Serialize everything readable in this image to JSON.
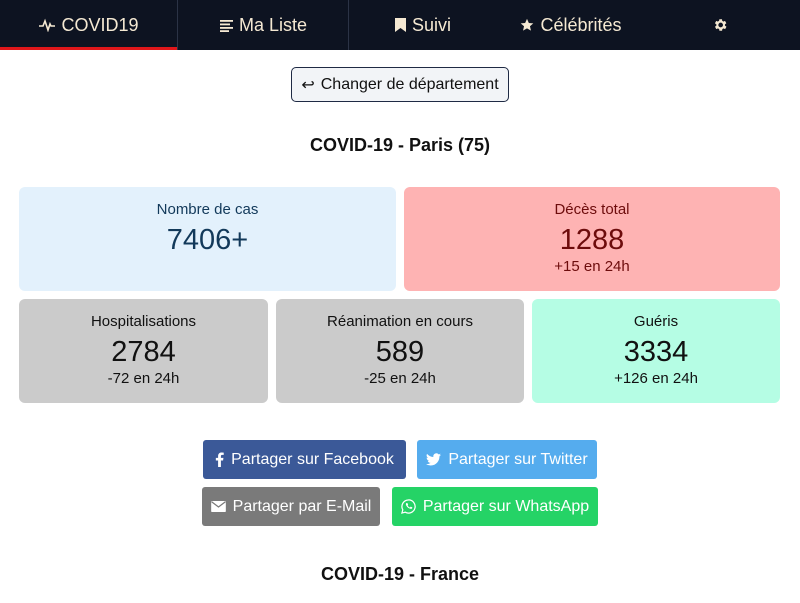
{
  "nav": {
    "items": [
      {
        "label": "COVID19",
        "icon": "pulse-icon"
      },
      {
        "label": "Ma Liste",
        "icon": "list-icon"
      },
      {
        "label": "Suivi",
        "icon": "bookmark-icon"
      },
      {
        "label": "Célébrités",
        "icon": "star-icon"
      },
      {
        "label": "",
        "icon": "gear-icon"
      }
    ],
    "active": 0
  },
  "change_button": {
    "label": "Changer de département",
    "icon": "return-arrow-icon"
  },
  "local_title": "COVID-19 - Paris (75)",
  "stats": {
    "cases": {
      "label": "Nombre de cas",
      "value": "7406+",
      "delta": ""
    },
    "deaths": {
      "label": "Décès total",
      "value": "1288",
      "delta": "+15 en 24h"
    },
    "hosp": {
      "label": "Hospitalisations",
      "value": "2784",
      "delta": "-72 en 24h"
    },
    "rea": {
      "label": "Réanimation en cours",
      "value": "589",
      "delta": "-25 en 24h"
    },
    "gueris": {
      "label": "Guéris",
      "value": "3334",
      "delta": "+126 en 24h"
    }
  },
  "share": {
    "facebook": "Partager sur Facebook",
    "twitter": "Partager sur Twitter",
    "email": "Partager par E-Mail",
    "whatsapp": "Partager sur WhatsApp"
  },
  "national_title": "COVID-19 - France",
  "colors": {
    "nav_bg": "#0d1321",
    "nav_text": "#f5e9d3",
    "active_underline": "#e0161a",
    "cases_bg": "#e3f1fc",
    "deaths_bg": "#feb3b3",
    "neutral_bg": "#cbcbcb",
    "gueris_bg": "#b5fde4",
    "facebook": "#3b5998",
    "twitter": "#55acee",
    "email": "#7a7a7a",
    "whatsapp": "#25d366"
  }
}
